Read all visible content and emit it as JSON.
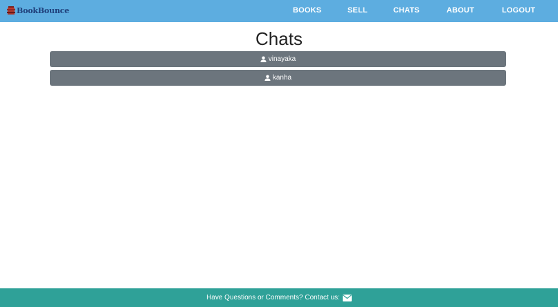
{
  "brand": {
    "name": "BookBounce"
  },
  "nav": {
    "items": [
      {
        "label": "BOOKS"
      },
      {
        "label": "SELL"
      },
      {
        "label": "CHATS"
      },
      {
        "label": "ABOUT"
      },
      {
        "label": "LOGOUT"
      }
    ]
  },
  "page": {
    "title": "Chats"
  },
  "chats": [
    {
      "username": "vinayaka"
    },
    {
      "username": "kanha"
    }
  ],
  "footer": {
    "text": "Have Questions or Comments? Contact us:"
  },
  "colors": {
    "navbar": "#5dade0",
    "chat_item": "#6c757d",
    "footer": "#2fa198"
  },
  "icons": {
    "brand": "book-stack-icon",
    "chat_user": "user-icon",
    "contact": "envelope-icon"
  }
}
